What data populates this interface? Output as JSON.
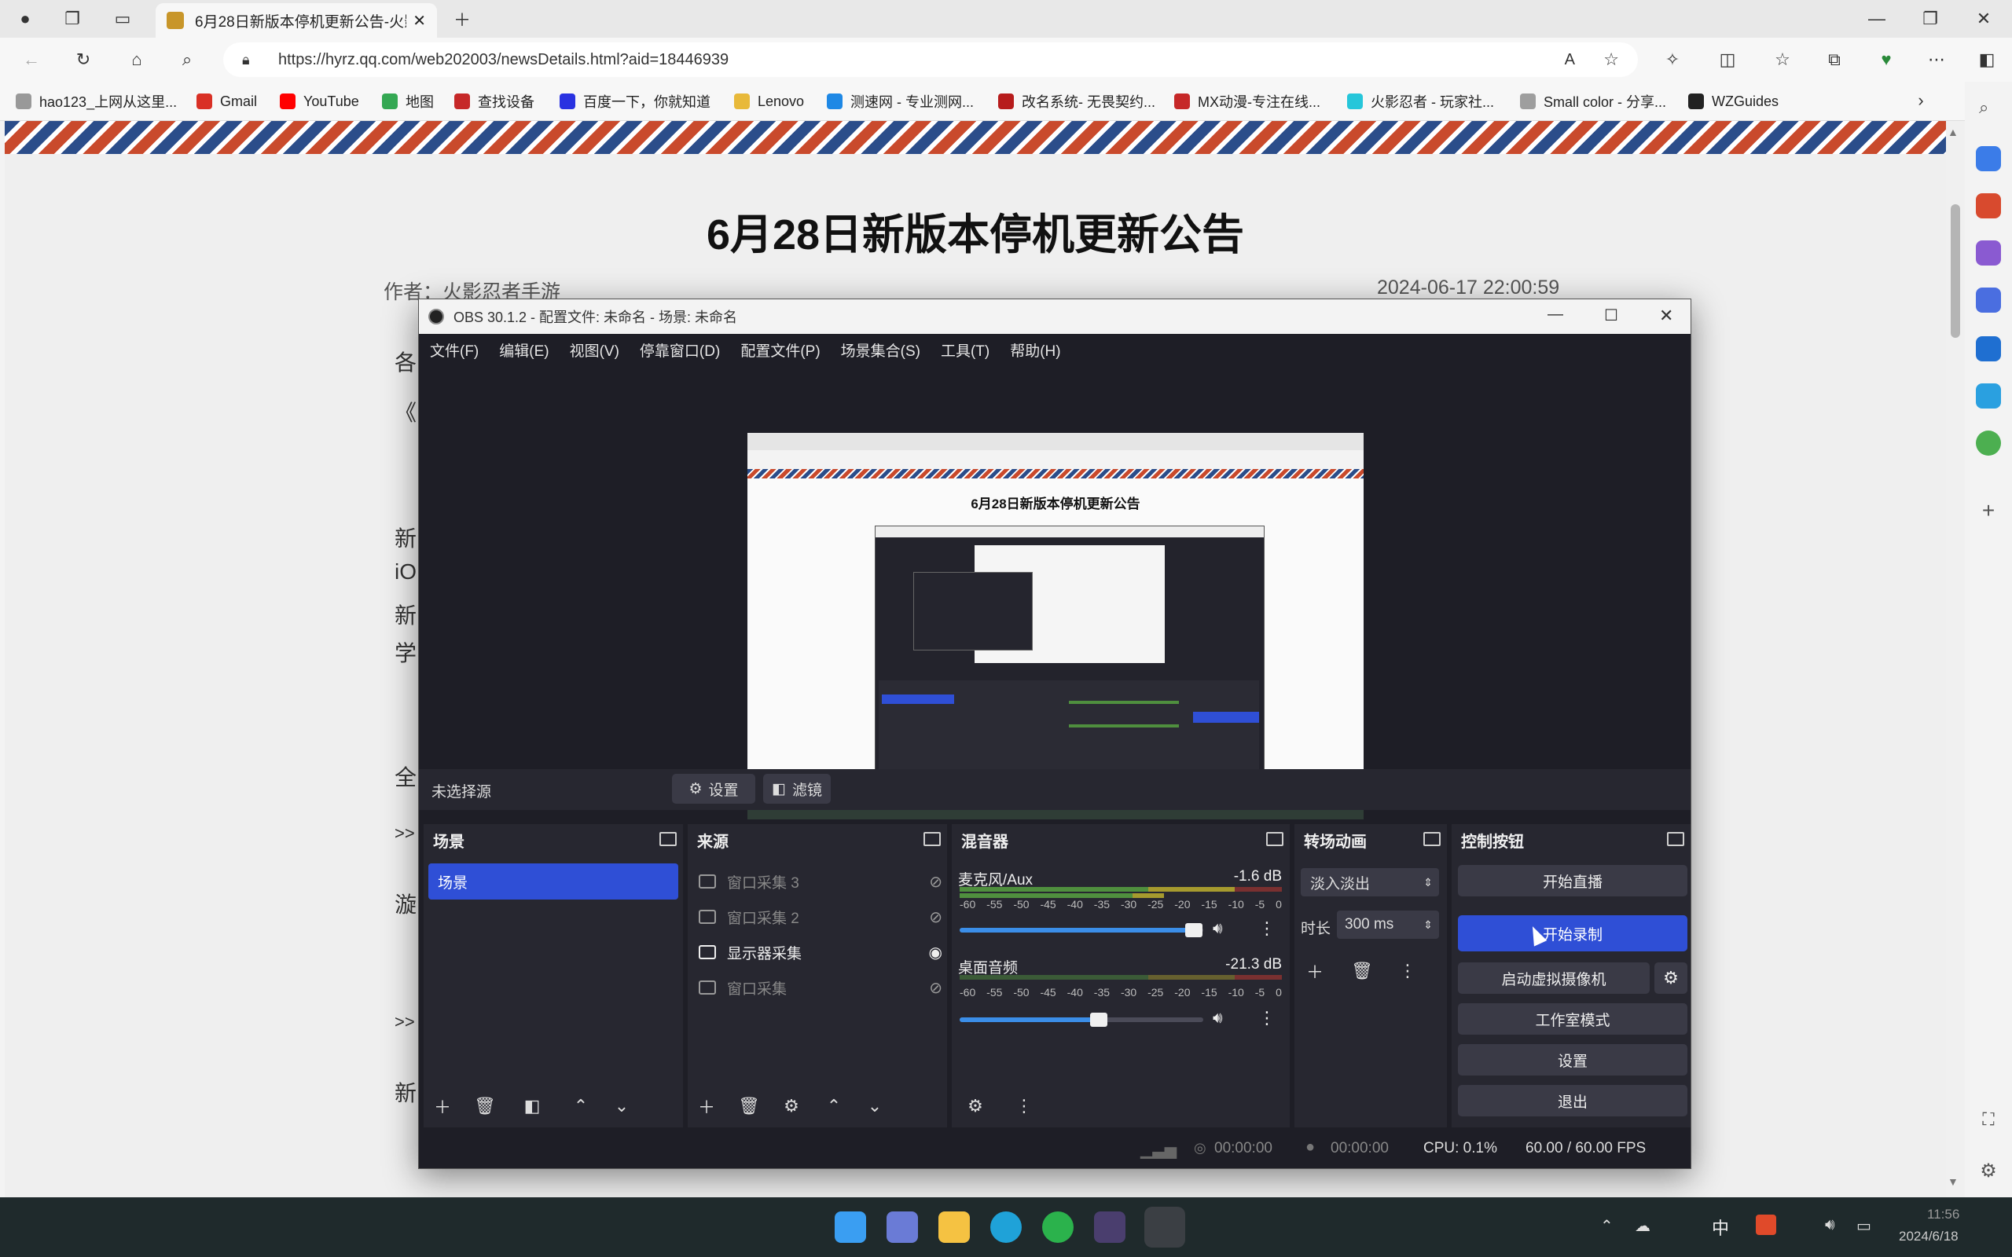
{
  "browser": {
    "tab_title": "6月28日新版本停机更新公告-火影",
    "url": "https://hyrz.qq.com/web202003/newsDetails.html?aid=18446939",
    "favorites": [
      {
        "label": "hao123_上网从这里...",
        "color": "#999999"
      },
      {
        "label": "Gmail",
        "color": "#d93025"
      },
      {
        "label": "YouTube",
        "color": "#ff0000"
      },
      {
        "label": "地图",
        "color": "#34a853"
      },
      {
        "label": "查找设备",
        "color": "#c62828"
      },
      {
        "label": "百度一下，你就知道",
        "color": "#2932e1"
      },
      {
        "label": "Lenovo",
        "color": "#e8b93a"
      },
      {
        "label": "测速网 - 专业测网...",
        "color": "#1e88e5"
      },
      {
        "label": "改名系统- 无畏契约...",
        "color": "#b71c1c"
      },
      {
        "label": "MX动漫-专注在线...",
        "color": "#c62828"
      },
      {
        "label": "火影忍者 - 玩家社...",
        "color": "#26c6da"
      },
      {
        "label": "Small color - 分享...",
        "color": "#9e9e9e"
      },
      {
        "label": "WZGuides",
        "color": "#222222"
      }
    ]
  },
  "page": {
    "title": "6月28日新版本停机更新公告",
    "author": "作者：火影忍者手游",
    "date": "2024-06-17 22:00:59",
    "fragments": [
      "各",
      "《",
      "新",
      "iO",
      "新",
      "学",
      "全",
      ">>",
      "漩",
      ">>",
      "新"
    ]
  },
  "obs": {
    "title": "OBS 30.1.2 - 配置文件: 未命名 - 场景: 未命名",
    "menu": [
      "文件(F)",
      "编辑(E)",
      "视图(V)",
      "停靠窗口(D)",
      "配置文件(P)",
      "场景集合(S)",
      "工具(T)",
      "帮助(H)"
    ],
    "preview": {
      "page_title": "6月28日新版本停机更新公告"
    },
    "context": {
      "no_source": "未选择源",
      "settings": "设置",
      "filters": "滤镜"
    },
    "scenes": {
      "header": "场景",
      "items": [
        "场景"
      ]
    },
    "sources": {
      "header": "来源",
      "items": [
        {
          "label": "窗口采集 3",
          "visible": false
        },
        {
          "label": "窗口采集 2",
          "visible": false
        },
        {
          "label": "显示器采集",
          "visible": true
        },
        {
          "label": "窗口采集",
          "visible": false
        }
      ]
    },
    "mixer": {
      "header": "混音器",
      "scale": [
        "-60",
        "-55",
        "-50",
        "-45",
        "-40",
        "-35",
        "-30",
        "-25",
        "-20",
        "-15",
        "-10",
        "-5",
        "0"
      ],
      "channels": [
        {
          "name": "麦克风/Aux",
          "db": "-1.6 dB",
          "volume": 0.96
        },
        {
          "name": "桌面音频",
          "db": "-21.3 dB",
          "volume": 0.57
        }
      ]
    },
    "transitions": {
      "header": "转场动画",
      "type": "淡入淡出",
      "duration_label": "时长",
      "duration": "300 ms"
    },
    "controls": {
      "header": "控制按钮",
      "start_stream": "开始直播",
      "start_record": "开始录制",
      "virtual_cam": "启动虚拟摄像机",
      "studio_mode": "工作室模式",
      "settings": "设置",
      "exit": "退出"
    },
    "status": {
      "stream_time": "00:00:00",
      "rec_time": "00:00:00",
      "cpu": "CPU: 0.1%",
      "fps": "60.00 / 60.00 FPS"
    }
  },
  "taskbar": {
    "ime": "中",
    "time": "11:56",
    "date": "2024/6/18"
  }
}
